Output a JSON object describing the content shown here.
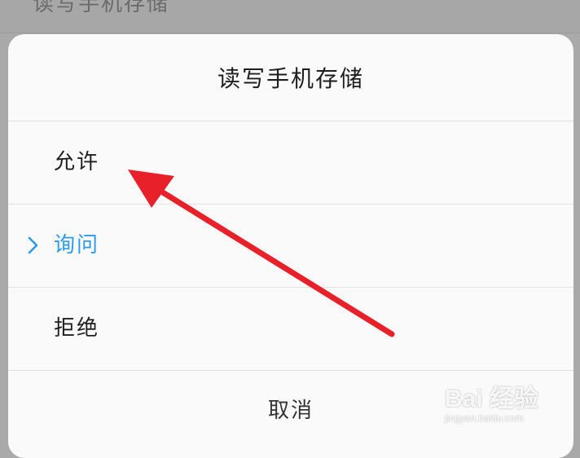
{
  "background": {
    "title": "读写手机存储"
  },
  "dialog": {
    "title": "读写手机存储",
    "options": [
      {
        "label": "允许",
        "selected": false
      },
      {
        "label": "询问",
        "selected": true
      },
      {
        "label": "拒绝",
        "selected": false
      }
    ],
    "cancel_label": "取消"
  },
  "annotation": {
    "color": "#e8202a",
    "icon": "red-arrow-icon"
  },
  "watermark": {
    "logo": "Bai 经验",
    "url": "jingyan.baidu.com"
  },
  "colors": {
    "accent": "#2d9bf0",
    "text": "#1e1e1e",
    "divider": "#e2e2e2"
  }
}
